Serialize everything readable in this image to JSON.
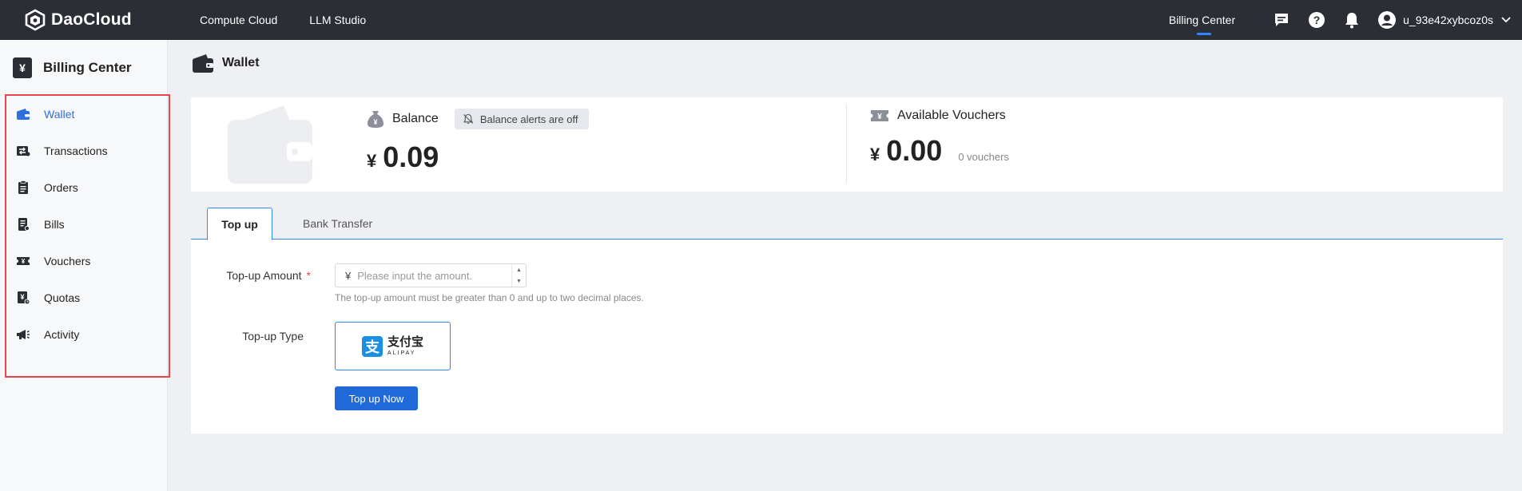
{
  "brand": {
    "name": "DaoCloud"
  },
  "topnav": {
    "items": [
      {
        "label": "Compute Cloud"
      },
      {
        "label": "LLM Studio"
      }
    ],
    "active_tab": "Billing Center",
    "user": "u_93e42xybcoz0s"
  },
  "sidebar": {
    "title": "Billing Center",
    "items": [
      {
        "label": "Wallet",
        "icon": "wallet-icon",
        "active": true
      },
      {
        "label": "Transactions",
        "icon": "transactions-icon"
      },
      {
        "label": "Orders",
        "icon": "clipboard-icon"
      },
      {
        "label": "Bills",
        "icon": "bill-icon"
      },
      {
        "label": "Vouchers",
        "icon": "ticket-icon"
      },
      {
        "label": "Quotas",
        "icon": "quota-icon"
      },
      {
        "label": "Activity",
        "icon": "megaphone-icon"
      }
    ]
  },
  "page": {
    "title": "Wallet"
  },
  "balance": {
    "label": "Balance",
    "alert_chip": "Balance alerts are off",
    "currency": "¥",
    "amount": "0.09"
  },
  "vouchers": {
    "label": "Available Vouchers",
    "currency": "¥",
    "amount": "0.00",
    "count": "0 vouchers"
  },
  "tabs": [
    {
      "label": "Top up",
      "active": true
    },
    {
      "label": "Bank Transfer"
    }
  ],
  "form": {
    "amount_label": "Top-up Amount",
    "required_mark": "*",
    "currency": "¥",
    "amount_placeholder": "Please input the amount.",
    "amount_value": "",
    "hint": "The top-up amount must be greater than 0 and up to two decimal places.",
    "type_label": "Top-up Type",
    "payment_cn": "支付宝",
    "payment_en": "ALIPAY",
    "submit_label": "Top up Now"
  },
  "colors": {
    "accent": "#1f6ad8",
    "topbar": "#2b2e35",
    "highlight": "#e8484d"
  }
}
